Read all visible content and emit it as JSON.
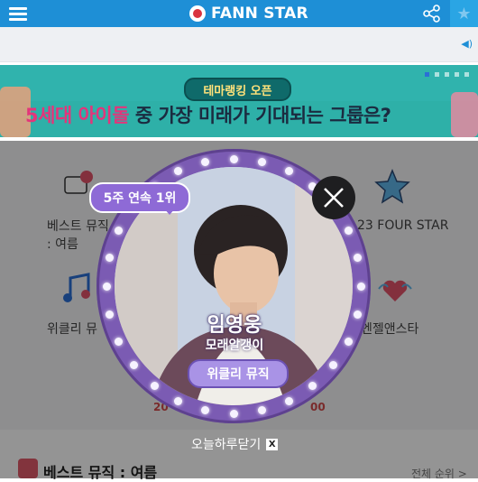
{
  "header": {
    "logo_text": "FANN STAR",
    "menu_icon": "hamburger-icon",
    "share_icon": "share-icon",
    "star_icon": "star-icon",
    "accent": "#1e8fd6"
  },
  "banner": {
    "pill": "테마랭킹 오픈",
    "title_highlight": "5세대 아이돌",
    "title_rest": " 중 가장 미래가 기대되는 그룹은?"
  },
  "grid": {
    "items": [
      {
        "label_line1": "베스트 뮤직",
        "label_line2": ": 여름"
      },
      {
        "label": "23 FOUR STAR"
      },
      {
        "label": "위클리 뮤"
      },
      {
        "label": "엔젤앤스타"
      }
    ],
    "numbers": [
      "20",
      "00"
    ]
  },
  "popup": {
    "badge": "5주 연속 1위",
    "name": "임영웅",
    "song": "모래알갱이",
    "button": "위클리 뮤직",
    "ring_color": "#7b5bb3"
  },
  "dismiss": {
    "label": "오늘하루닫기",
    "x": "X"
  },
  "bottom": {
    "title": "베스트 뮤직 : 여름",
    "see_all": "전체 순위 >"
  }
}
